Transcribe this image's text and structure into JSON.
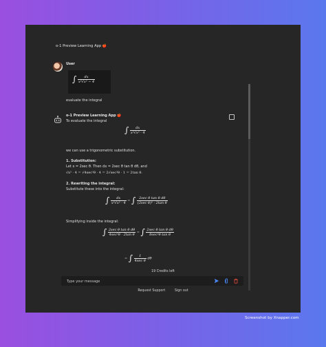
{
  "app": {
    "title": "o-1 Preview Learning App",
    "emoji": "🍎"
  },
  "messages": {
    "user": {
      "name": "User",
      "integral_num": "dx",
      "integral_den": "x²√x² − 4",
      "text": "evaluate the integral"
    },
    "assistant": {
      "name": "o-1 Preview Learning App",
      "intro": "To evaluate the integral",
      "integral_num": "dx",
      "integral_den": "x²√x² · 4",
      "sub_intro": "we can use a trigonometric substitution.",
      "step1_title": "1. Substitution:",
      "step1_line1": "Let x = 2sec θ. Then dx = 2sec θ tan θ dθ, and",
      "step1_line2": "√x² · 4 = √4sec²θ · 4 = 2√sec²θ · 1 = 2tan θ.",
      "step2_title": "2. Rewriting the integral:",
      "step2_line1": "Substitute these into the integral:",
      "eq1_lhs_num": "dx",
      "eq1_lhs_den": "x²√x² · 4",
      "eq1_rhs_num": "2sec θ tan θ dθ",
      "eq1_rhs_den": "(2sec θ)² · 2tan θ",
      "simplify_text": "Simplifying inside the integral:",
      "eq2_lhs_num": "2sec θ tan θ dθ",
      "eq2_lhs_den": "4sec²θ · 2tan θ",
      "eq2_rhs_num": "2sec θ tan θ dθ",
      "eq2_rhs_den": "8sec²θ tan θ",
      "eq3_num": "1",
      "eq3_den": "4sec θ",
      "eq3_tail": "dθ"
    }
  },
  "credits": "19 Credits left",
  "input": {
    "placeholder": "Type your message"
  },
  "footer": {
    "request_support": "Request Support",
    "sign_out": "Sign out"
  },
  "watermark": "Screenshot by Xnapper.com",
  "colors": {
    "send": "#4b86f5",
    "attach": "#4b86f5",
    "trash": "#e0493d"
  }
}
